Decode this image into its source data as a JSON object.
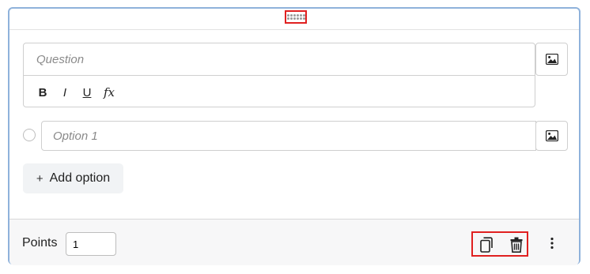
{
  "question": {
    "placeholder": "Question",
    "format_buttons": [
      {
        "label": "B",
        "name": "bold"
      },
      {
        "label": "I",
        "name": "italic"
      },
      {
        "label": "U",
        "name": "underline"
      },
      {
        "label": "fx",
        "name": "formula"
      }
    ],
    "image_icon": "image-icon"
  },
  "options": [
    {
      "placeholder": "Option 1",
      "image_icon": "image-icon"
    }
  ],
  "add_option": {
    "icon": "+",
    "label": "Add option"
  },
  "footer": {
    "points_label": "Points",
    "points_value": "1",
    "duplicate_icon": "copy-icon",
    "delete_icon": "trash-icon",
    "more_icon": "more-vertical-icon"
  },
  "colors": {
    "card_border": "#8fb2db",
    "highlight": "#e02020",
    "footer_bg": "#f7f7f8",
    "button_bg": "#f1f3f5"
  }
}
